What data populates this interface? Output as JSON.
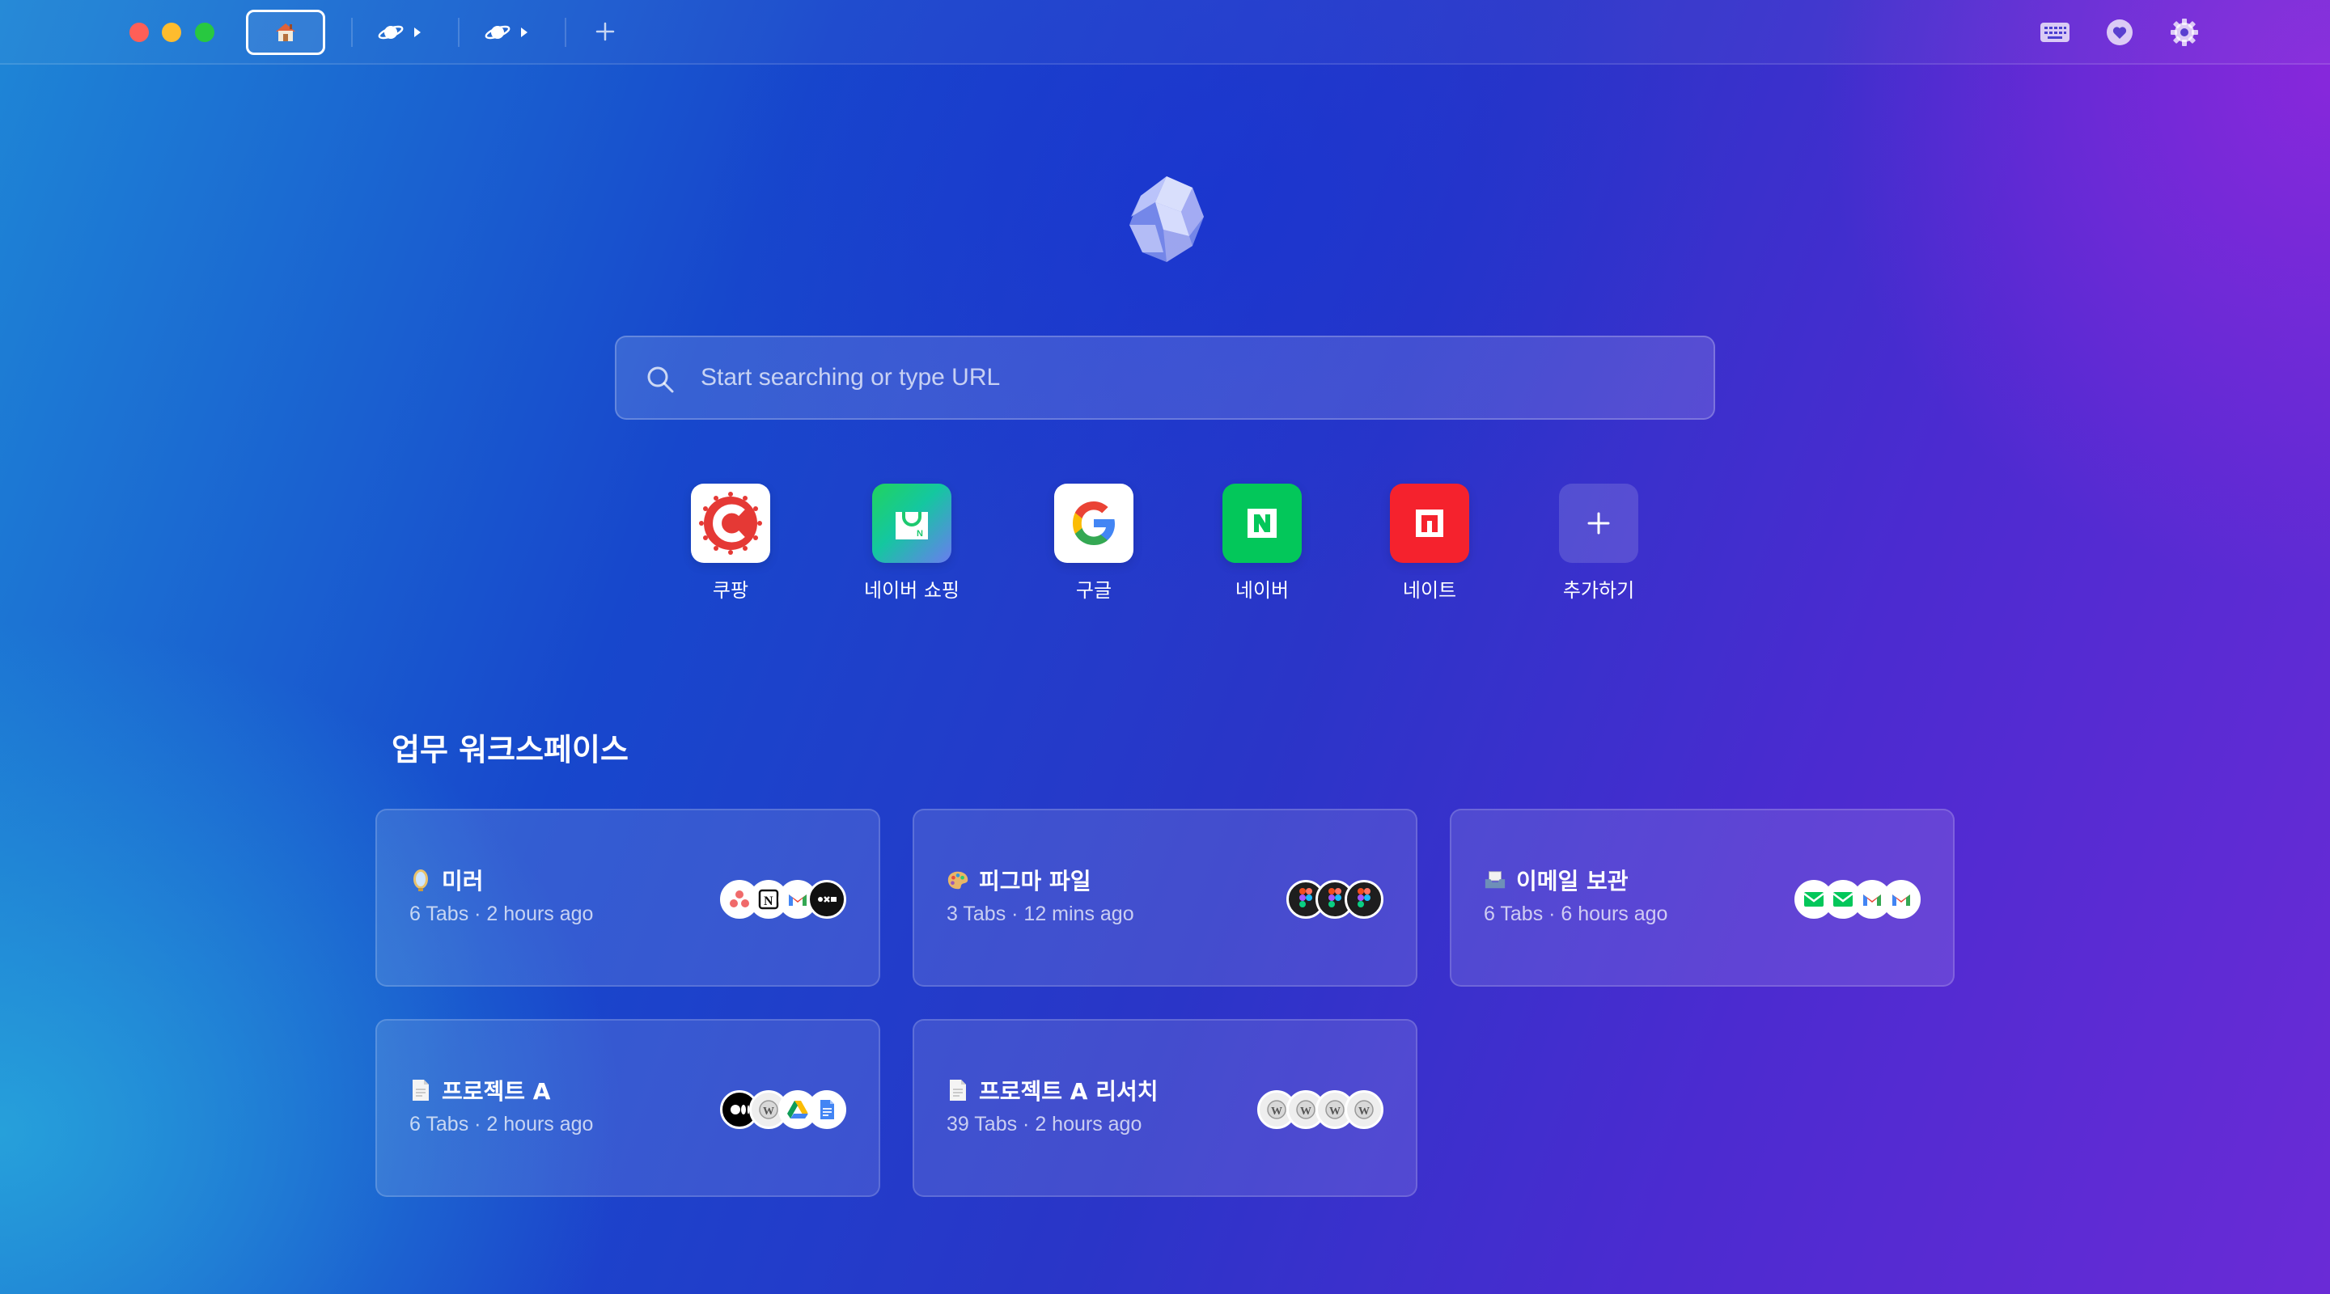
{
  "colors": {
    "coupang_red": "#e53935",
    "naver_green": "#03c75a",
    "nate_red": "#f5222d",
    "add_tile": "rgba(255,255,255,0.15)"
  },
  "topbar": {
    "tabs": [
      {
        "icon": "home-icon"
      },
      {
        "icon": "planet-icon"
      },
      {
        "icon": "planet-icon"
      }
    ],
    "actions": [
      "keyboard-icon",
      "heart-icon",
      "gear-icon"
    ]
  },
  "search": {
    "placeholder": "Start searching or type URL"
  },
  "shortcuts": [
    {
      "label": "쿠팡",
      "icon": "coupang-icon"
    },
    {
      "label": "네이버 쇼핑",
      "icon": "naver-shopping-icon"
    },
    {
      "label": "구글",
      "icon": "google-icon"
    },
    {
      "label": "네이버",
      "icon": "naver-icon"
    },
    {
      "label": "네이트",
      "icon": "nate-icon"
    },
    {
      "label": "추가하기",
      "icon": "plus-icon",
      "symbol": "+"
    }
  ],
  "workspace": {
    "title": "업무 워크스페이스",
    "cards": [
      {
        "title": "미러",
        "meta": "6 Tabs · 2 hours ago",
        "emoji": "mirror-icon",
        "favicons": [
          "asana-icon",
          "notion-icon",
          "gmail-icon",
          "miro-icon"
        ]
      },
      {
        "title": "피그마 파일",
        "meta": "3 Tabs · 12 mins ago",
        "emoji": "palette-icon",
        "favicons": [
          "figma-icon",
          "figma-icon",
          "figma-icon"
        ]
      },
      {
        "title": "이메일 보관",
        "meta": "6 Tabs · 6 hours ago",
        "emoji": "inbox-tray-icon",
        "favicons": [
          "mail-icon",
          "mail-icon",
          "gmail-icon",
          "gmail-icon"
        ]
      },
      {
        "title": "프로젝트 A",
        "meta": "6 Tabs · 2 hours ago",
        "emoji": "document-icon",
        "favicons": [
          "medium-icon",
          "wikipedia-icon",
          "google-drive-icon",
          "google-docs-icon"
        ]
      },
      {
        "title": "프로젝트 A 리서치",
        "meta": "39 Tabs · 2 hours ago",
        "emoji": "document-icon",
        "favicons": [
          "wikipedia-icon",
          "wikipedia-icon",
          "wikipedia-icon",
          "wikipedia-icon"
        ]
      }
    ]
  },
  "favicon_text": {
    "notion": "N",
    "gmail": "M",
    "wikipedia": "W",
    "naver": "N"
  }
}
